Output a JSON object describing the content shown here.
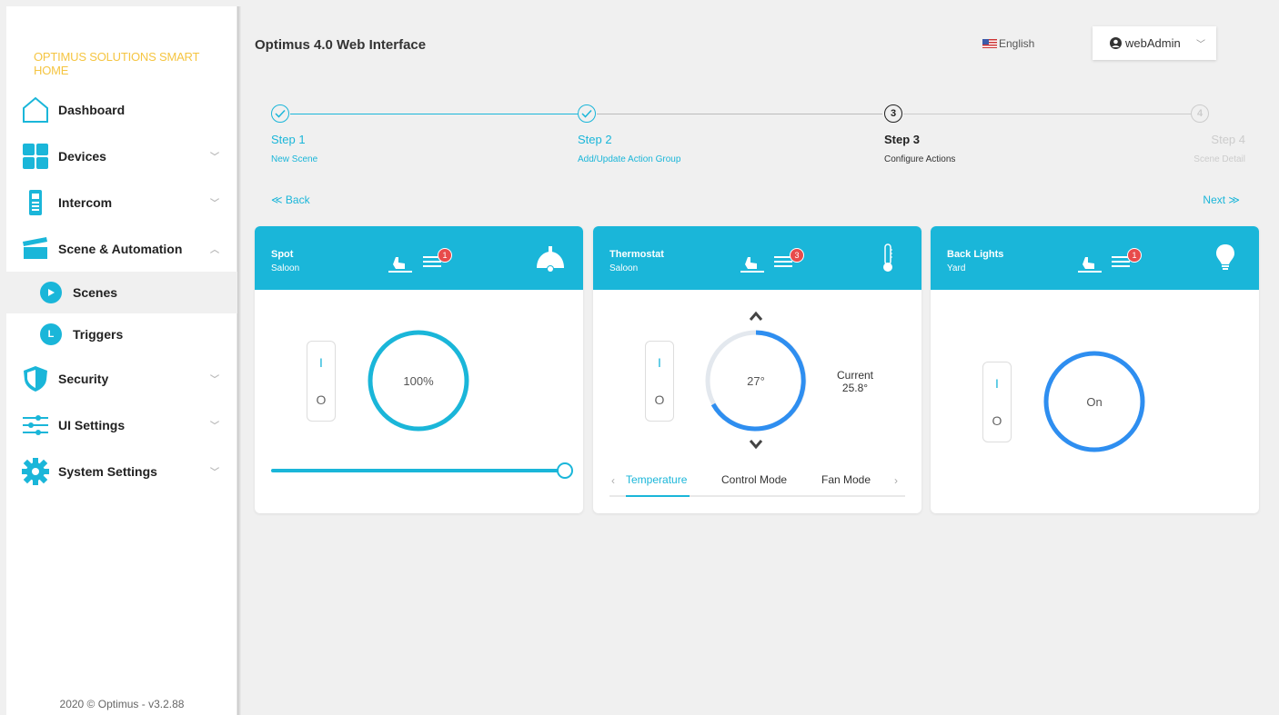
{
  "brand": "OPTIMUS SOLUTIONS SMART HOME",
  "sidebar": {
    "items": [
      {
        "label": "Dashboard",
        "icon": "home-icon"
      },
      {
        "label": "Devices",
        "icon": "grid-icon"
      },
      {
        "label": "Intercom",
        "icon": "intercom-icon"
      },
      {
        "label": "Scene & Automation",
        "icon": "clapperboard-icon"
      }
    ],
    "sub": [
      {
        "label": "Scenes",
        "icon": "play-icon"
      },
      {
        "label": "Triggers",
        "icon": "trigger-icon",
        "glyph": "L"
      }
    ],
    "items2": [
      {
        "label": "Security",
        "icon": "shield-icon"
      },
      {
        "label": "UI Settings",
        "icon": "sliders-icon"
      },
      {
        "label": "System Settings",
        "icon": "gear-icon"
      }
    ]
  },
  "footer": "2020 © Optimus - v3.2.88",
  "header": {
    "title": "Optimus 4.0 Web Interface",
    "language": "English",
    "user": "webAdmin"
  },
  "stepper": [
    {
      "num": "1",
      "title": "Step 1",
      "sub": "New Scene",
      "state": "done"
    },
    {
      "num": "2",
      "title": "Step 2",
      "sub": "Add/Update Action Group",
      "state": "done"
    },
    {
      "num": "3",
      "title": "Step 3",
      "sub": "Configure Actions",
      "state": "current"
    },
    {
      "num": "4",
      "title": "Step 4",
      "sub": "Scene Detail",
      "state": "todo"
    }
  ],
  "nav": {
    "back": "≪ Back",
    "next": "Next ≫"
  },
  "cards": [
    {
      "name": "Spot",
      "location": "Saloon",
      "badge": "1",
      "type_icon": "lamp-icon",
      "toggle_on": "I",
      "toggle_off": "O",
      "value": "100%",
      "level": 1.0
    },
    {
      "name": "Thermostat",
      "location": "Saloon",
      "badge": "3",
      "type_icon": "thermometer-icon",
      "toggle_on": "I",
      "toggle_off": "O",
      "value": "27°",
      "current_label": "Current",
      "current_value": "25.8°",
      "tabs": [
        "Temperature",
        "Control Mode",
        "Fan Mode"
      ]
    },
    {
      "name": "Back Lights",
      "location": "Yard",
      "badge": "1",
      "type_icon": "bulb-icon",
      "toggle_on": "I",
      "toggle_off": "O",
      "value": "On"
    }
  ],
  "colors": {
    "accent": "#1ab6d9",
    "blue": "#2e8ef0",
    "badge": "#e84b4b",
    "brand": "#f5c542"
  }
}
